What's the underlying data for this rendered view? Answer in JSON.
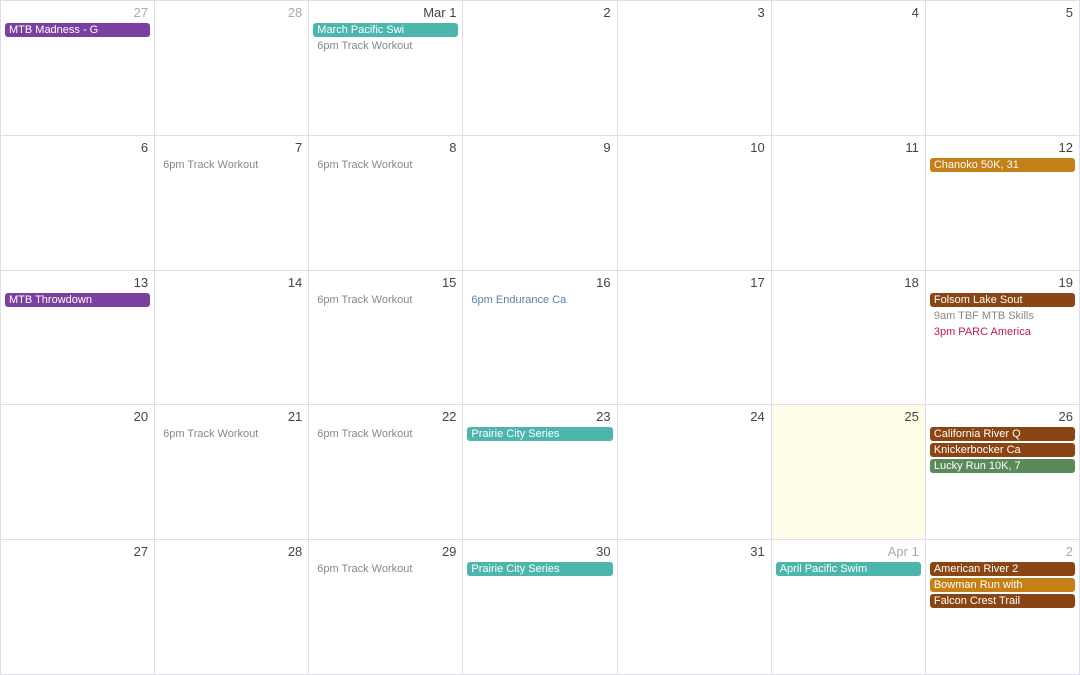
{
  "calendar": {
    "weeks": [
      {
        "days": [
          {
            "num": "27",
            "type": "prev-month",
            "events": [
              {
                "label": "MTB Madness - G",
                "style": "purple"
              }
            ]
          },
          {
            "num": "28",
            "type": "prev-month",
            "events": []
          },
          {
            "num": "Mar 1",
            "type": "current",
            "events": [
              {
                "label": "March Pacific Swi",
                "style": "teal"
              },
              {
                "label": "6pm Track Workout",
                "style": "gray-text"
              }
            ]
          },
          {
            "num": "2",
            "type": "current",
            "events": []
          },
          {
            "num": "3",
            "type": "current",
            "events": []
          },
          {
            "num": "4",
            "type": "current",
            "events": []
          },
          {
            "num": "5",
            "type": "current",
            "events": []
          }
        ]
      },
      {
        "days": [
          {
            "num": "6",
            "type": "current",
            "events": []
          },
          {
            "num": "7",
            "type": "current",
            "events": [
              {
                "label": "6pm Track Workout",
                "style": "gray-text"
              }
            ]
          },
          {
            "num": "8",
            "type": "current",
            "events": [
              {
                "label": "6pm Track Workout",
                "style": "gray-text"
              }
            ]
          },
          {
            "num": "9",
            "type": "current",
            "events": []
          },
          {
            "num": "10",
            "type": "current",
            "events": []
          },
          {
            "num": "11",
            "type": "current",
            "events": []
          },
          {
            "num": "12",
            "type": "current",
            "events": [
              {
                "label": "Chanoko 50K, 31",
                "style": "orange"
              }
            ]
          }
        ]
      },
      {
        "days": [
          {
            "num": "13",
            "type": "current",
            "events": [
              {
                "label": "MTB Throwdown",
                "style": "purple"
              }
            ]
          },
          {
            "num": "14",
            "type": "current",
            "events": []
          },
          {
            "num": "15",
            "type": "current",
            "events": [
              {
                "label": "6pm Track Workout",
                "style": "gray-text"
              }
            ]
          },
          {
            "num": "16",
            "type": "current",
            "events": [
              {
                "label": "6pm Endurance Ca",
                "style": "blue-text"
              }
            ]
          },
          {
            "num": "17",
            "type": "current",
            "events": []
          },
          {
            "num": "18",
            "type": "current",
            "events": []
          },
          {
            "num": "19",
            "type": "current",
            "events": [
              {
                "label": "Folsom Lake Sout",
                "style": "brown"
              },
              {
                "label": "9am TBF MTB Skills",
                "style": "gray-text"
              },
              {
                "label": "3pm PARC America",
                "style": "pink-text"
              }
            ]
          }
        ]
      },
      {
        "days": [
          {
            "num": "20",
            "type": "current",
            "events": []
          },
          {
            "num": "21",
            "type": "current",
            "events": [
              {
                "label": "6pm Track Workout",
                "style": "gray-text"
              }
            ]
          },
          {
            "num": "22",
            "type": "current",
            "events": [
              {
                "label": "6pm Track Workout",
                "style": "gray-text"
              }
            ]
          },
          {
            "num": "23",
            "type": "current",
            "events": [
              {
                "label": "Prairie City Series",
                "style": "teal"
              }
            ]
          },
          {
            "num": "24",
            "type": "current",
            "events": []
          },
          {
            "num": "25",
            "type": "today",
            "events": []
          },
          {
            "num": "26",
            "type": "current",
            "events": [
              {
                "label": "California River Q",
                "style": "brown"
              },
              {
                "label": "Knickerbocker Ca",
                "style": "brown"
              },
              {
                "label": "Lucky Run 10K, 7",
                "style": "green"
              }
            ]
          }
        ]
      },
      {
        "days": [
          {
            "num": "27",
            "type": "current",
            "events": []
          },
          {
            "num": "28",
            "type": "current",
            "events": []
          },
          {
            "num": "29",
            "type": "current",
            "events": [
              {
                "label": "6pm Track Workout",
                "style": "gray-text"
              }
            ]
          },
          {
            "num": "30",
            "type": "current",
            "events": [
              {
                "label": "Prairie City Series",
                "style": "teal"
              }
            ]
          },
          {
            "num": "31",
            "type": "current",
            "events": []
          },
          {
            "num": "Apr 1",
            "type": "next-month",
            "events": [
              {
                "label": "April Pacific Swim",
                "style": "teal"
              }
            ]
          },
          {
            "num": "2",
            "type": "next-month",
            "events": [
              {
                "label": "American River 2",
                "style": "brown"
              },
              {
                "label": "Bowman Run with",
                "style": "orange"
              },
              {
                "label": "Falcon Crest Trail",
                "style": "brown"
              }
            ]
          }
        ]
      }
    ]
  }
}
